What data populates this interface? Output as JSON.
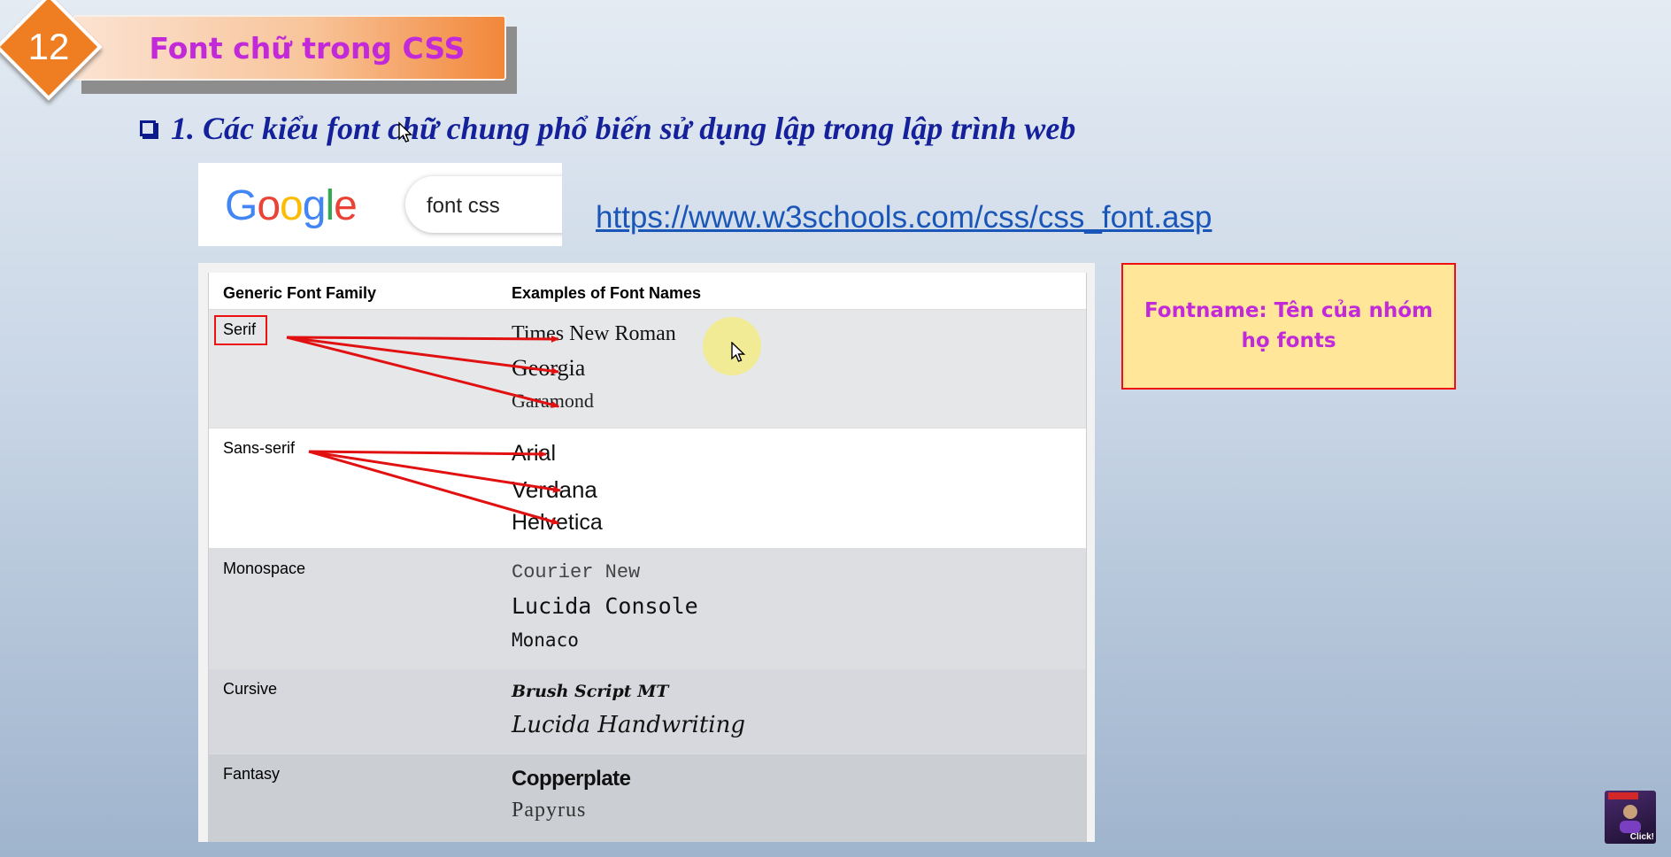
{
  "slide": {
    "number": "12",
    "title": "Font chữ trong CSS",
    "heading": "1. Các kiểu font chữ chung phổ biến sử dụng lập trong lập trình web"
  },
  "search": {
    "logo": "Google",
    "query": "font css"
  },
  "link": {
    "url": "https://www.w3schools.com/css/css_font.asp"
  },
  "table": {
    "headers": [
      "Generic Font Family",
      "Examples of Font Names"
    ],
    "rows": [
      {
        "family": "Serif",
        "examples": [
          "Times New Roman",
          "Georgia",
          "Garamond"
        ]
      },
      {
        "family": "Sans-serif",
        "examples": [
          "Arial",
          "Verdana",
          "Helvetica"
        ]
      },
      {
        "family": "Monospace",
        "examples": [
          "Courier New",
          "Lucida Console",
          "Monaco"
        ]
      },
      {
        "family": "Cursive",
        "examples": [
          "Brush Script MT",
          "Lucida Handwriting"
        ]
      },
      {
        "family": "Fantasy",
        "examples": [
          "Copperplate",
          "Papyrus"
        ]
      }
    ]
  },
  "note": {
    "text": "Fontname: Tên của nhóm họ fonts"
  },
  "badge": {
    "label": "Click!"
  },
  "colors": {
    "title_text": "#c22ad9",
    "heading_text": "#14219a",
    "link": "#1a56b8",
    "annotation_red": "#e11111",
    "note_bg": "#ffe699",
    "diamond": "#ef7e22"
  }
}
